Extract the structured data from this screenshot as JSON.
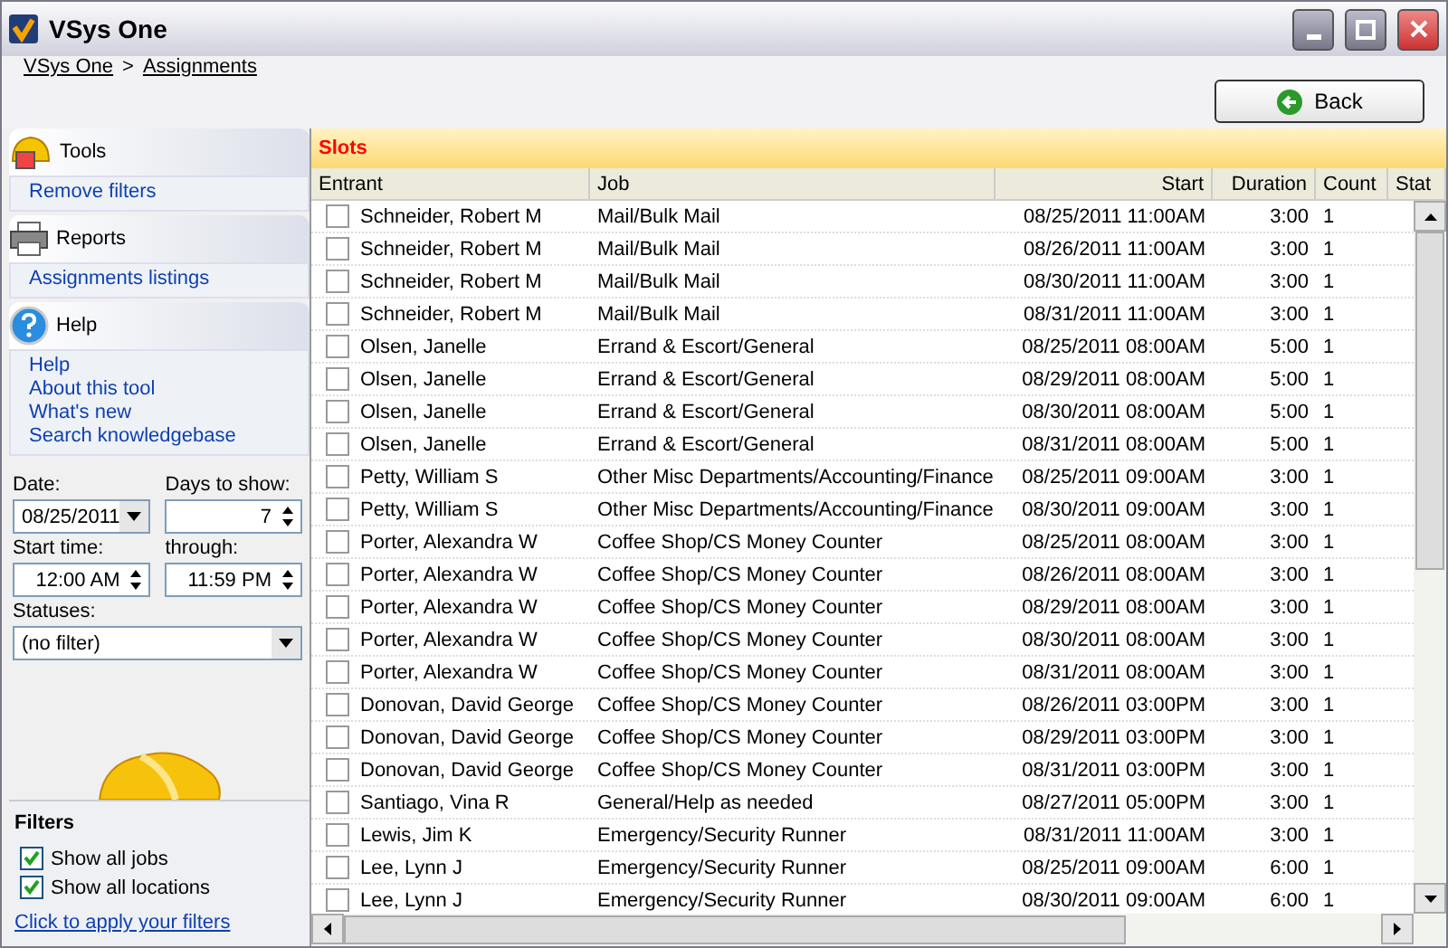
{
  "window": {
    "title": "VSys One"
  },
  "breadcrumb": [
    "VSys One",
    "Assignments"
  ],
  "breadcrumb_separator": ">",
  "back_button": "Back",
  "sidebar": {
    "sections": [
      {
        "kind": "tools",
        "title": "Tools",
        "links": [
          "Remove filters"
        ]
      },
      {
        "kind": "reports",
        "title": "Reports",
        "links": [
          "Assignments listings"
        ]
      },
      {
        "kind": "help",
        "title": "Help",
        "links": [
          "Help",
          "About this tool",
          "What's new",
          "Search knowledgebase"
        ]
      }
    ],
    "date": {
      "label": "Date:",
      "value": "08/25/2011"
    },
    "days": {
      "label": "Days to show:",
      "value": "7"
    },
    "start_time": {
      "label": "Start time:",
      "value": "12:00 AM"
    },
    "through": {
      "label": "through:",
      "value": "11:59 PM"
    },
    "statuses": {
      "label": "Statuses:",
      "value": "(no filter)"
    },
    "filters": {
      "title": "Filters",
      "options": [
        {
          "label": "Show all jobs",
          "checked": true
        },
        {
          "label": "Show all locations",
          "checked": true
        }
      ],
      "apply_link": "Click to apply your filters"
    }
  },
  "slots": {
    "title": "Slots",
    "columns": [
      "Entrant",
      "Job",
      "Start",
      "Duration",
      "Count",
      "Stat"
    ],
    "rows": [
      {
        "checked": false,
        "cells": [
          "Schneider, Robert M",
          "Mail/Bulk Mail",
          "08/25/2011 11:00AM",
          "3:00",
          "1"
        ]
      },
      {
        "checked": false,
        "cells": [
          "Schneider, Robert M",
          "Mail/Bulk Mail",
          "08/26/2011 11:00AM",
          "3:00",
          "1"
        ]
      },
      {
        "checked": false,
        "cells": [
          "Schneider, Robert M",
          "Mail/Bulk Mail",
          "08/30/2011 11:00AM",
          "3:00",
          "1"
        ]
      },
      {
        "checked": false,
        "cells": [
          "Schneider, Robert M",
          "Mail/Bulk Mail",
          "08/31/2011 11:00AM",
          "3:00",
          "1"
        ]
      },
      {
        "checked": false,
        "cells": [
          "Olsen, Janelle",
          "Errand & Escort/General",
          "08/25/2011 08:00AM",
          "5:00",
          "1"
        ]
      },
      {
        "checked": false,
        "cells": [
          "Olsen, Janelle",
          "Errand & Escort/General",
          "08/29/2011 08:00AM",
          "5:00",
          "1"
        ]
      },
      {
        "checked": false,
        "cells": [
          "Olsen, Janelle",
          "Errand & Escort/General",
          "08/30/2011 08:00AM",
          "5:00",
          "1"
        ]
      },
      {
        "checked": false,
        "cells": [
          "Olsen, Janelle",
          "Errand & Escort/General",
          "08/31/2011 08:00AM",
          "5:00",
          "1"
        ]
      },
      {
        "checked": false,
        "cells": [
          "Petty, William S",
          "Other Misc Departments/Accounting/Finance",
          "08/25/2011 09:00AM",
          "3:00",
          "1"
        ]
      },
      {
        "checked": false,
        "cells": [
          "Petty, William S",
          "Other Misc Departments/Accounting/Finance",
          "08/30/2011 09:00AM",
          "3:00",
          "1"
        ]
      },
      {
        "checked": false,
        "cells": [
          "Porter, Alexandra W",
          "Coffee Shop/CS Money Counter",
          "08/25/2011 08:00AM",
          "3:00",
          "1"
        ]
      },
      {
        "checked": false,
        "cells": [
          "Porter, Alexandra W",
          "Coffee Shop/CS Money Counter",
          "08/26/2011 08:00AM",
          "3:00",
          "1"
        ]
      },
      {
        "checked": false,
        "cells": [
          "Porter, Alexandra W",
          "Coffee Shop/CS Money Counter",
          "08/29/2011 08:00AM",
          "3:00",
          "1"
        ]
      },
      {
        "checked": false,
        "cells": [
          "Porter, Alexandra W",
          "Coffee Shop/CS Money Counter",
          "08/30/2011 08:00AM",
          "3:00",
          "1"
        ]
      },
      {
        "checked": false,
        "cells": [
          "Porter, Alexandra W",
          "Coffee Shop/CS Money Counter",
          "08/31/2011 08:00AM",
          "3:00",
          "1"
        ]
      },
      {
        "checked": false,
        "cells": [
          "Donovan, David George",
          "Coffee Shop/CS Money Counter",
          "08/26/2011 03:00PM",
          "3:00",
          "1"
        ]
      },
      {
        "checked": false,
        "cells": [
          "Donovan, David George",
          "Coffee Shop/CS Money Counter",
          "08/29/2011 03:00PM",
          "3:00",
          "1"
        ]
      },
      {
        "checked": false,
        "cells": [
          "Donovan, David George",
          "Coffee Shop/CS Money Counter",
          "08/31/2011 03:00PM",
          "3:00",
          "1"
        ]
      },
      {
        "checked": false,
        "cells": [
          "Santiago, Vina R",
          "General/Help as needed",
          "08/27/2011 05:00PM",
          "3:00",
          "1"
        ]
      },
      {
        "checked": false,
        "cells": [
          "Lewis, Jim K",
          "Emergency/Security Runner",
          "08/31/2011 11:00AM",
          "3:00",
          "1"
        ]
      },
      {
        "checked": false,
        "cells": [
          "Lee, Lynn J",
          "Emergency/Security Runner",
          "08/25/2011 09:00AM",
          "6:00",
          "1"
        ]
      },
      {
        "checked": false,
        "cells": [
          "Lee, Lynn J",
          "Emergency/Security Runner",
          "08/30/2011 09:00AM",
          "6:00",
          "1"
        ]
      }
    ]
  }
}
